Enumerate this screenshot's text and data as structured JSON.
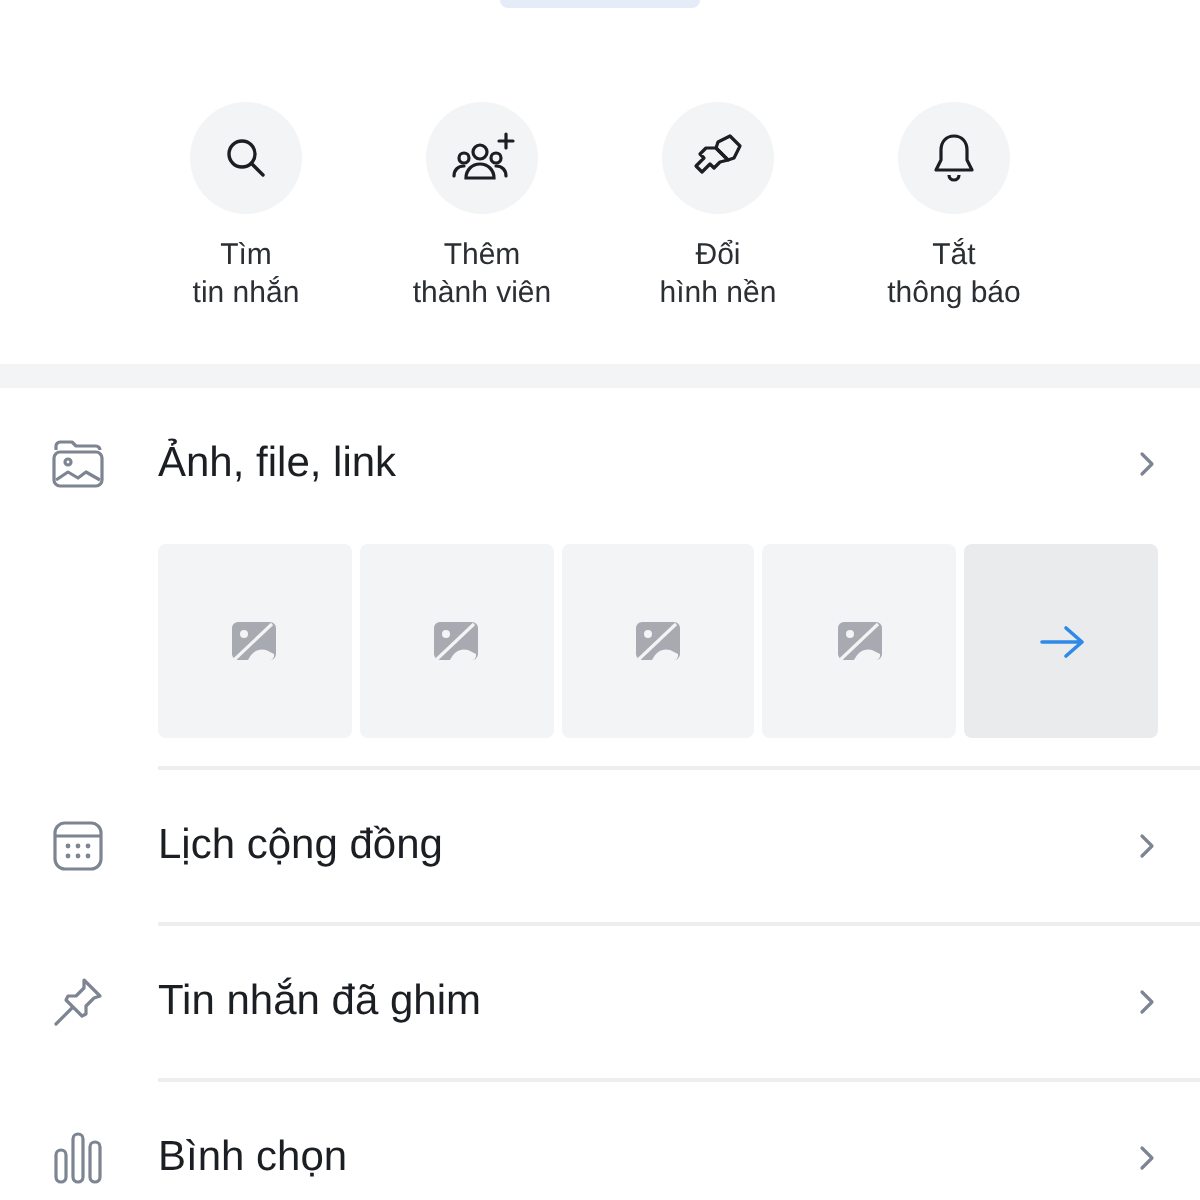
{
  "quick_actions": [
    {
      "kind": "search",
      "label": "Tìm\ntin nhắn"
    },
    {
      "kind": "add_member",
      "label": "Thêm\nthành viên"
    },
    {
      "kind": "wallpaper",
      "label": "Đổi\nhình nền"
    },
    {
      "kind": "mute",
      "label": "Tắt\nthông báo"
    }
  ],
  "media": {
    "title": "Ảnh, file, link",
    "thumbnails": [
      {
        "kind": "picture"
      },
      {
        "kind": "picture"
      },
      {
        "kind": "picture"
      },
      {
        "kind": "picture"
      },
      {
        "kind": "more"
      }
    ]
  },
  "rows": [
    {
      "kind": "calendar",
      "label": "Lịch cộng đồng"
    },
    {
      "kind": "pin",
      "label": "Tin nhắn đã ghim"
    },
    {
      "kind": "poll",
      "label": "Bình chọn"
    }
  ]
}
